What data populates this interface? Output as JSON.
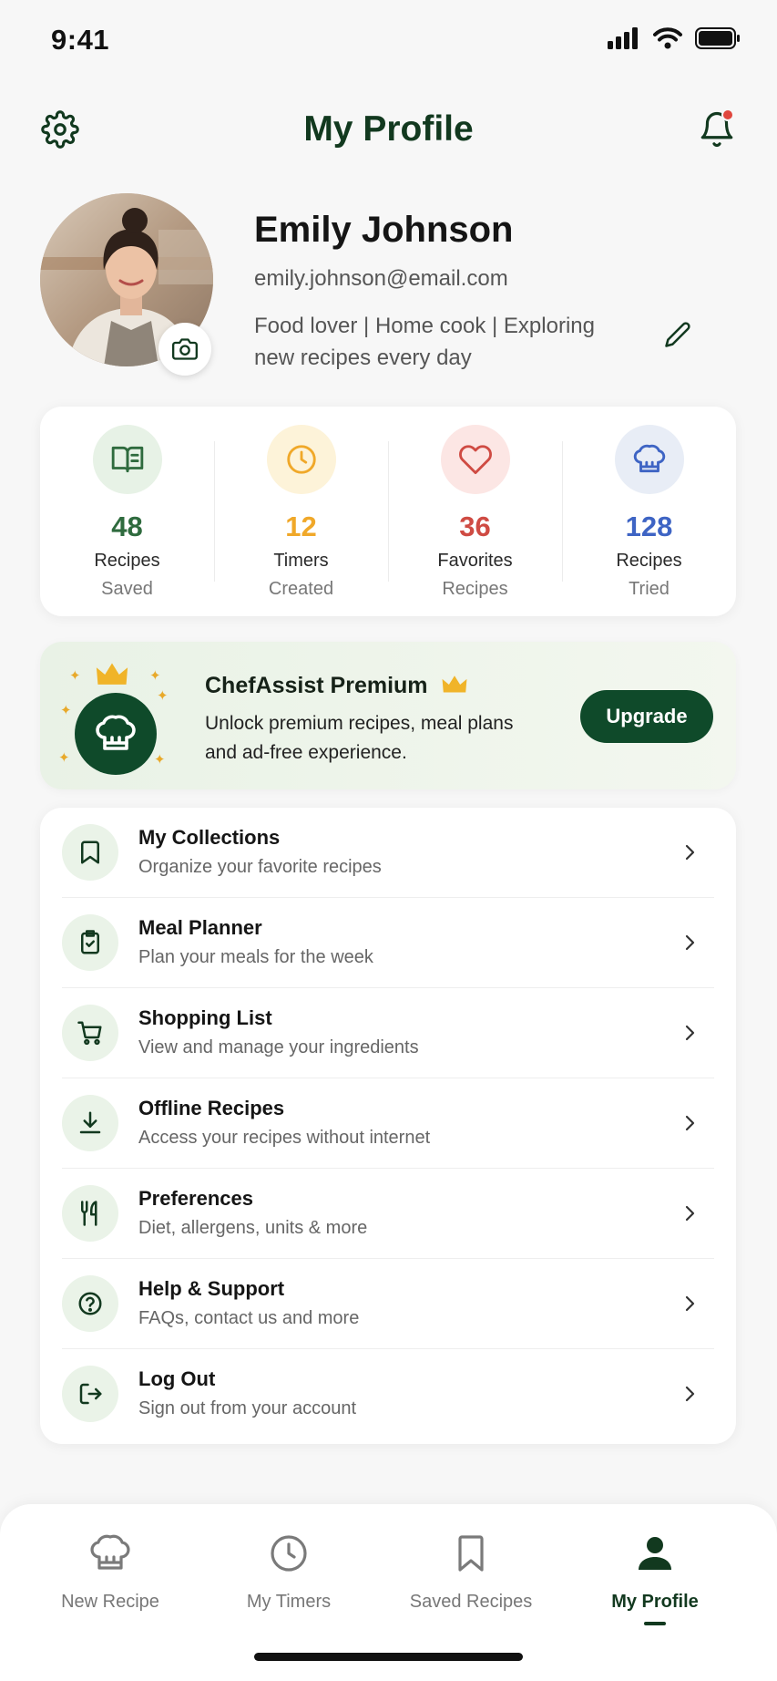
{
  "status_bar": {
    "time": "9:41"
  },
  "header": {
    "title": "My Profile",
    "has_notification": true
  },
  "profile": {
    "name": "Emily Johnson",
    "email": "emily.johnson@email.com",
    "bio": "Food lover | Home cook | Exploring new recipes every day"
  },
  "stats": [
    {
      "value": "48",
      "label1": "Recipes",
      "label2": "Saved",
      "icon": "open-book-icon",
      "color": "#2f6b3e",
      "bg": "#e7f2e6"
    },
    {
      "value": "12",
      "label1": "Timers",
      "label2": "Created",
      "icon": "clock-icon",
      "color": "#f0a829",
      "bg": "#fdf3d9"
    },
    {
      "value": "36",
      "label1": "Favorites",
      "label2": "Recipes",
      "icon": "heart-icon",
      "color": "#cf4b43",
      "bg": "#fce6e4"
    },
    {
      "value": "128",
      "label1": "Recipes",
      "label2": "Tried",
      "icon": "chef-hat-icon",
      "color": "#3e64c4",
      "bg": "#e8edf6"
    }
  ],
  "premium": {
    "title": "ChefAssist Premium",
    "description": "Unlock premium recipes, meal plans and ad-free experience.",
    "button_label": "Upgrade"
  },
  "menu": [
    {
      "title": "My Collections",
      "subtitle": "Organize your favorite recipes",
      "icon": "bookmark-icon"
    },
    {
      "title": "Meal Planner",
      "subtitle": "Plan your meals for the week",
      "icon": "clipboard-check-icon"
    },
    {
      "title": "Shopping List",
      "subtitle": "View and manage your ingredients",
      "icon": "cart-icon"
    },
    {
      "title": "Offline Recipes",
      "subtitle": "Access your recipes without internet",
      "icon": "download-icon"
    },
    {
      "title": "Preferences",
      "subtitle": "Diet, allergens, units & more",
      "icon": "utensils-icon"
    },
    {
      "title": "Help & Support",
      "subtitle": "FAQs, contact us and more",
      "icon": "help-circle-icon"
    },
    {
      "title": "Log Out",
      "subtitle": "Sign out from your account",
      "icon": "logout-icon"
    }
  ],
  "bottom_nav": [
    {
      "label": "New Recipe",
      "icon": "chef-hat-icon",
      "active": false
    },
    {
      "label": "My Timers",
      "icon": "clock-icon",
      "active": false
    },
    {
      "label": "Saved Recipes",
      "icon": "bookmark-icon",
      "active": false
    },
    {
      "label": "My Profile",
      "icon": "person-icon",
      "active": true
    }
  ],
  "colors": {
    "primary": "#12391f",
    "button": "#0f4a2a",
    "accent_gold": "#e8a92a",
    "notification": "#e0473e"
  }
}
